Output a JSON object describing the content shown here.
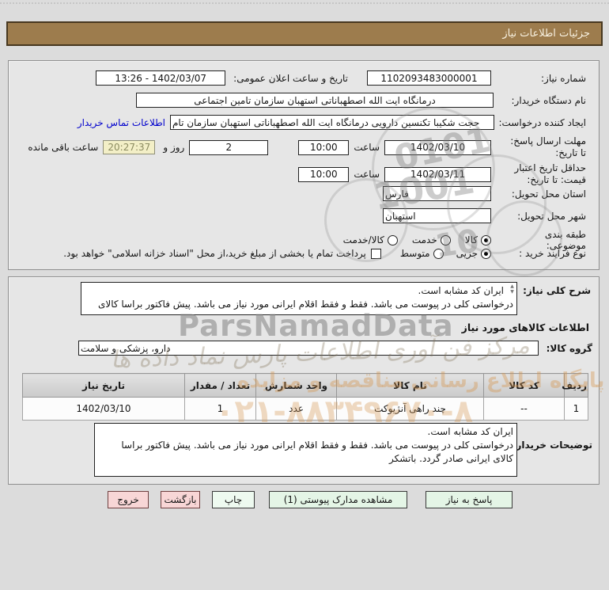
{
  "title_bar": {
    "title": "جزئیات اطلاعات نیاز"
  },
  "form": {
    "need_number_label": "شماره نیاز:",
    "need_number": "1102093483000001",
    "announce_datetime_label": "تاریخ و ساعت اعلان عمومی:",
    "announce_datetime": "1402/03/07 - 13:26",
    "buyer_org_label": "نام دستگاه خریدار:",
    "buyer_org": "درمانگاه ایت الله اصطهباناتی استهبان سازمان تامین اجتماعی",
    "request_creator_label": "ایجاد کننده درخواست:",
    "request_creator": "حجت  شکیبا تکنسین دارویی درمانگاه ایت الله اصطهباناتی استهبان سازمان تام",
    "buyer_contact_link": "اطلاعات تماس خریدار",
    "response_deadline_label": "مهلت ارسال پاسخ: تا تاریخ:",
    "response_deadline_date": "1402/03/10",
    "hour_label": "ساعت",
    "response_deadline_time": "10:00",
    "days_remaining": "2",
    "days_and_label": "روز و",
    "time_remaining": "20:27:37",
    "hours_remaining_label": "ساعت باقی مانده",
    "min_price_validity_label": "حداقل تاریخ اعتبار قیمت: تا تاریخ:",
    "min_price_validity_date": "1402/03/11",
    "min_price_validity_time": "10:00",
    "delivery_province_label": "استان محل تحویل:",
    "delivery_province": "فارس",
    "delivery_city_label": "شهر محل تحویل:",
    "delivery_city": "استهبان",
    "subject_class_label": "طبقه بندی موضوعی:",
    "option_goods": "کالا",
    "option_service": "خدمت",
    "option_goods_service": "کالا/خدمت",
    "purchase_type_label": "نوع فرآیند خرید :",
    "option_partial": "جزیی",
    "option_medium": "متوسط",
    "treasury_note": "پرداخت تمام یا بخشی از مبلغ خرید،از محل \"اسناد خزانه اسلامی\" خواهد بود."
  },
  "need_section": {
    "general_desc_label": "شرح کلی نیاز:",
    "general_desc_line1": "ایران کد مشابه است.",
    "general_desc_line2": "درخواستی کلی در پیوست می باشد. فقط و فقط اقلام ایرانی مورد نیاز می باشد. پیش فاکتور براسا کالای",
    "goods_info_header": "اطلاعات کالاهای مورد نیاز",
    "goods_group_label": "گروه کالا:",
    "goods_group": "دارو، پزشکی و سلامت"
  },
  "goods_table": {
    "headers": [
      "ردیف",
      "کد کالا",
      "نام کالا",
      "واحد شمارش",
      "تعداد / مقدار",
      "تاریخ نیاز"
    ],
    "rows": [
      {
        "row_no": "1",
        "code": "--",
        "name": "چند راهی آنژیوکت",
        "unit": "عدد",
        "qty": "1",
        "need_date": "1402/03/10"
      }
    ]
  },
  "buyer_remarks": {
    "label": "توضیحات خریدار:",
    "line1": "ایران کد مشابه است.",
    "line2": "درخواستی کلی در پیوست می باشد. فقط و فقط اقلام ایرانی مورد نیاز می باشد. پیش فاکتور براسا",
    "line3": "کالای ایرانی  صادر گردد. باتشکر"
  },
  "buttons": {
    "respond": "پاسخ به نیاز",
    "view_attachments": "مشاهده مدارک پیوستی (1)",
    "print": "چاپ",
    "back": "بازگشت",
    "exit": "خروج"
  },
  "watermark": {
    "brand": "ParsNamadData",
    "calligraphy": "مرکز فن آوری اطلاعات پارس نماد داده ها",
    "portal_line": "پایگاه اطلاع رسانی مناقصه و مزایده",
    "phone": "۰۲۱-۸۸۳۴۹۶۷۰-۸",
    "digits1": "0101",
    "digits2": "1001",
    "digits3": "10"
  },
  "colors": {
    "accent": "#9d7c4d",
    "link": "#0000cd",
    "highlight": "#f3efc7",
    "button_green": "#e4f5e6",
    "button_pink": "#f8d6d6"
  }
}
